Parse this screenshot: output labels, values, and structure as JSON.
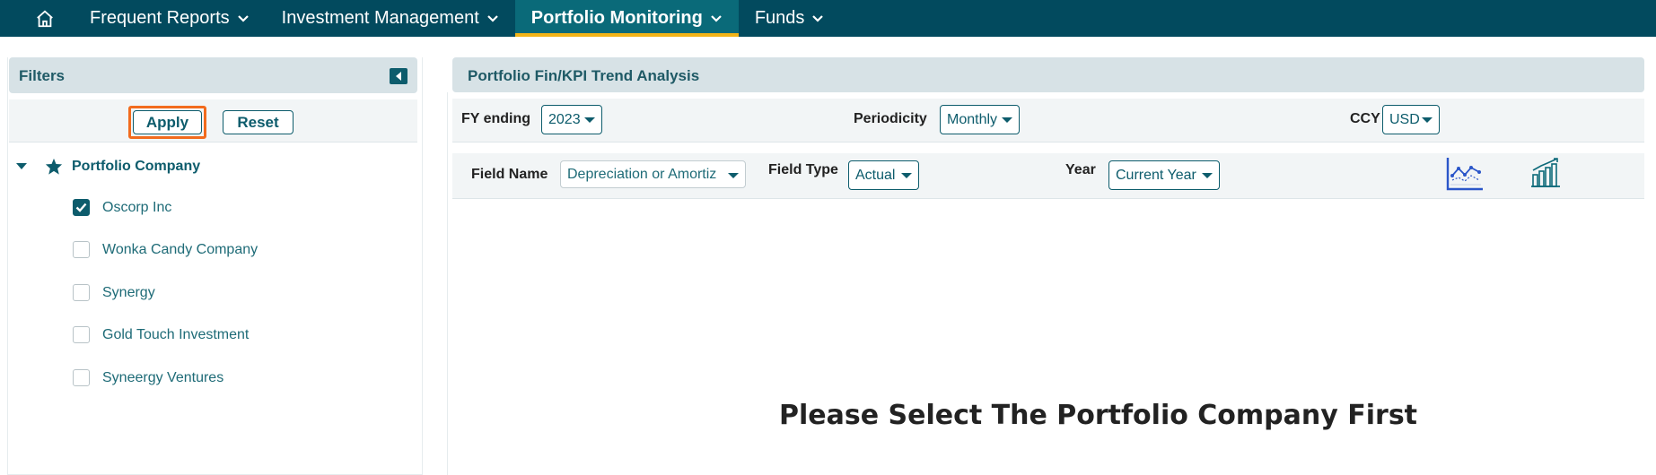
{
  "nav": {
    "items": [
      {
        "label": "Frequent Reports"
      },
      {
        "label": "Investment Management"
      },
      {
        "label": "Portfolio Monitoring"
      },
      {
        "label": "Funds"
      }
    ],
    "active": "Portfolio Monitoring",
    "home_icon": "home-icon",
    "colors": {
      "bar": "#024a5e",
      "active": "#0a6a79",
      "active_underline": "#f2b317"
    }
  },
  "filters": {
    "title": "Filters",
    "apply_label": "Apply",
    "reset_label": "Reset",
    "tree_label": "Portfolio Company",
    "companies": [
      {
        "name": "Oscorp Inc",
        "checked": true
      },
      {
        "name": "Wonka Candy Company",
        "checked": false
      },
      {
        "name": "Synergy",
        "checked": false
      },
      {
        "name": "Gold Touch Investment",
        "checked": false
      },
      {
        "name": "Syneergy Ventures",
        "checked": false
      }
    ]
  },
  "main": {
    "title": "Portfolio Fin/KPI Trend Analysis",
    "fy_label": "FY ending",
    "fy_value": "2023",
    "periodicity_label": "Periodicity",
    "periodicity_value": "Monthly",
    "ccy_label": "CCY",
    "ccy_value": "USD",
    "field_name_label": "Field Name",
    "field_name_value": "Depreciation or Amortiz",
    "field_type_label": "Field Type",
    "field_type_value": "Actual",
    "year_label": "Year",
    "year_value": "Current Year",
    "empty_message": "Please Select The Portfolio Company First"
  }
}
